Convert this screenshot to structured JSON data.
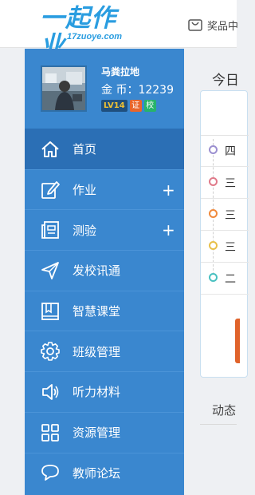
{
  "header": {
    "logo_main": "一起作业",
    "logo_sub": "17zuoye.com",
    "mall_label": "奖品中"
  },
  "profile": {
    "name": "马粪拉地",
    "gold_label": "金 币：12239",
    "level": "LV14",
    "cert_badge": "证",
    "school_badge": "校"
  },
  "sidebar": {
    "items": [
      {
        "label": "首页",
        "icon": "home-icon",
        "active": true
      },
      {
        "label": "作业",
        "icon": "edit-icon",
        "plus": "+"
      },
      {
        "label": "测验",
        "icon": "quiz-icon",
        "plus": "+"
      },
      {
        "label": "发校讯通",
        "icon": "send-icon"
      },
      {
        "label": "智慧课堂",
        "icon": "book-icon"
      },
      {
        "label": "班级管理",
        "icon": "gear-icon"
      },
      {
        "label": "听力材料",
        "icon": "speaker-icon"
      },
      {
        "label": "资源管理",
        "icon": "grid-icon"
      },
      {
        "label": "教师论坛",
        "icon": "chat-icon"
      }
    ]
  },
  "main": {
    "title": "今日",
    "timeline": [
      {
        "text": "四",
        "color": "#9b8fd0"
      },
      {
        "text": "三",
        "color": "#e07a8a"
      },
      {
        "text": "三",
        "color": "#f08a3c"
      },
      {
        "text": "三",
        "color": "#e8c04a"
      },
      {
        "text": "二",
        "color": "#49c0c0"
      }
    ],
    "feed_title": "动态"
  },
  "colors": {
    "sidebar": "#3a87cf",
    "sidebar_active": "#2b6fb5",
    "logo": "#2a9de0"
  }
}
